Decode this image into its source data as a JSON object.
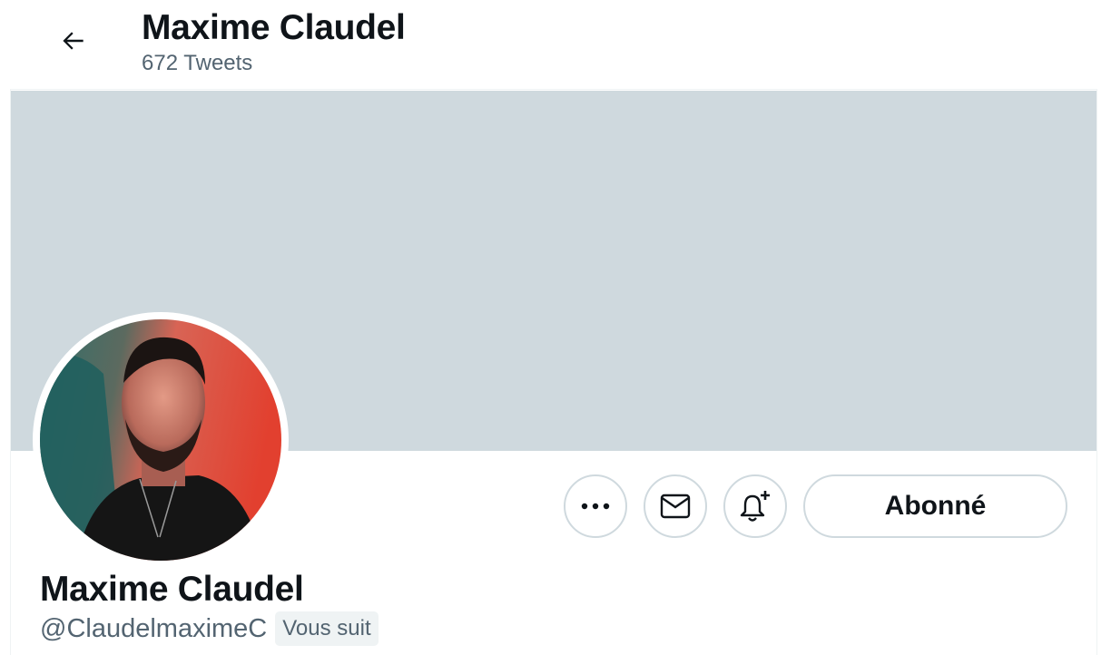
{
  "header": {
    "title": "Maxime Claudel",
    "tweet_count": "672 Tweets"
  },
  "profile": {
    "name": "Maxime Claudel",
    "handle": "@ClaudelmaximeC",
    "follows_you_badge": "Vous suit",
    "follow_button_label": "Abonné"
  },
  "icons": {
    "back": "arrow-left-icon",
    "more": "more-dots-icon",
    "message": "envelope-icon",
    "notify": "bell-plus-icon"
  },
  "colors": {
    "banner": "#cfd9de",
    "text_primary": "#0f1419",
    "text_secondary": "#536471",
    "border": "#cfd9de"
  }
}
